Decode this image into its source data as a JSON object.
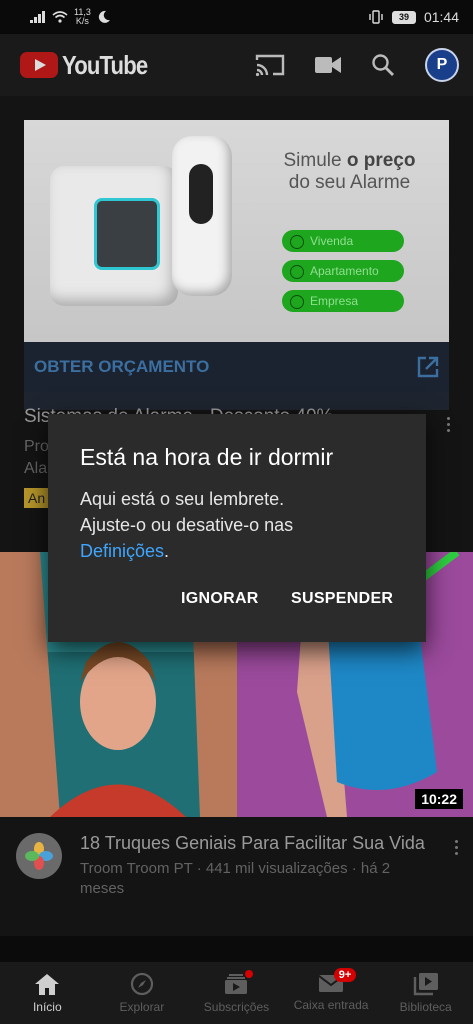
{
  "status_bar": {
    "net_speed_value": "11,3",
    "net_speed_unit": "K/s",
    "battery": "39",
    "time": "01:44"
  },
  "app_bar": {
    "logo_text": "YouTube",
    "avatar_letter": "P",
    "icons": [
      "cast-icon",
      "camera-icon",
      "search-icon",
      "account-avatar"
    ]
  },
  "ad": {
    "headline_part1": "Simule",
    "headline_bold": "o preço",
    "headline_part2": "do seu Alarme",
    "options": [
      "Vivenda",
      "Apartamento",
      "Empresa"
    ],
    "cta": "OBTER ORÇAMENTO",
    "title": "Sistemas de Alarme - Desconto 40%",
    "desc_line1": "Pro",
    "desc_line2": "Ala",
    "badge": "An"
  },
  "video": {
    "duration": "10:22",
    "title": "18 Truques Geniais Para Facilitar Sua Vida",
    "subtitle": "Troom Troom PT · 441 mil visualizações · há 2 meses"
  },
  "dialog": {
    "title": "Está na hora de ir dormir",
    "body_line1": "Aqui está o seu lembrete.",
    "body_line2": "Ajuste-o ou desative-o nas",
    "link": "Definições",
    "link_suffix": ".",
    "dismiss": "IGNORAR",
    "snooze": "SUSPENDER"
  },
  "bottom_nav": {
    "items": [
      {
        "label": "Início",
        "active": true
      },
      {
        "label": "Explorar",
        "active": false
      },
      {
        "label": "Subscrições",
        "active": false
      },
      {
        "label": "Caixa entrada",
        "active": false,
        "badge": "9+"
      },
      {
        "label": "Biblioteca",
        "active": false
      }
    ]
  },
  "colors": {
    "brand_red": "#d50000",
    "link_blue": "#3ea6ff",
    "dialog_bg": "#2b2b2b",
    "ad_green": "#1ea61e"
  }
}
